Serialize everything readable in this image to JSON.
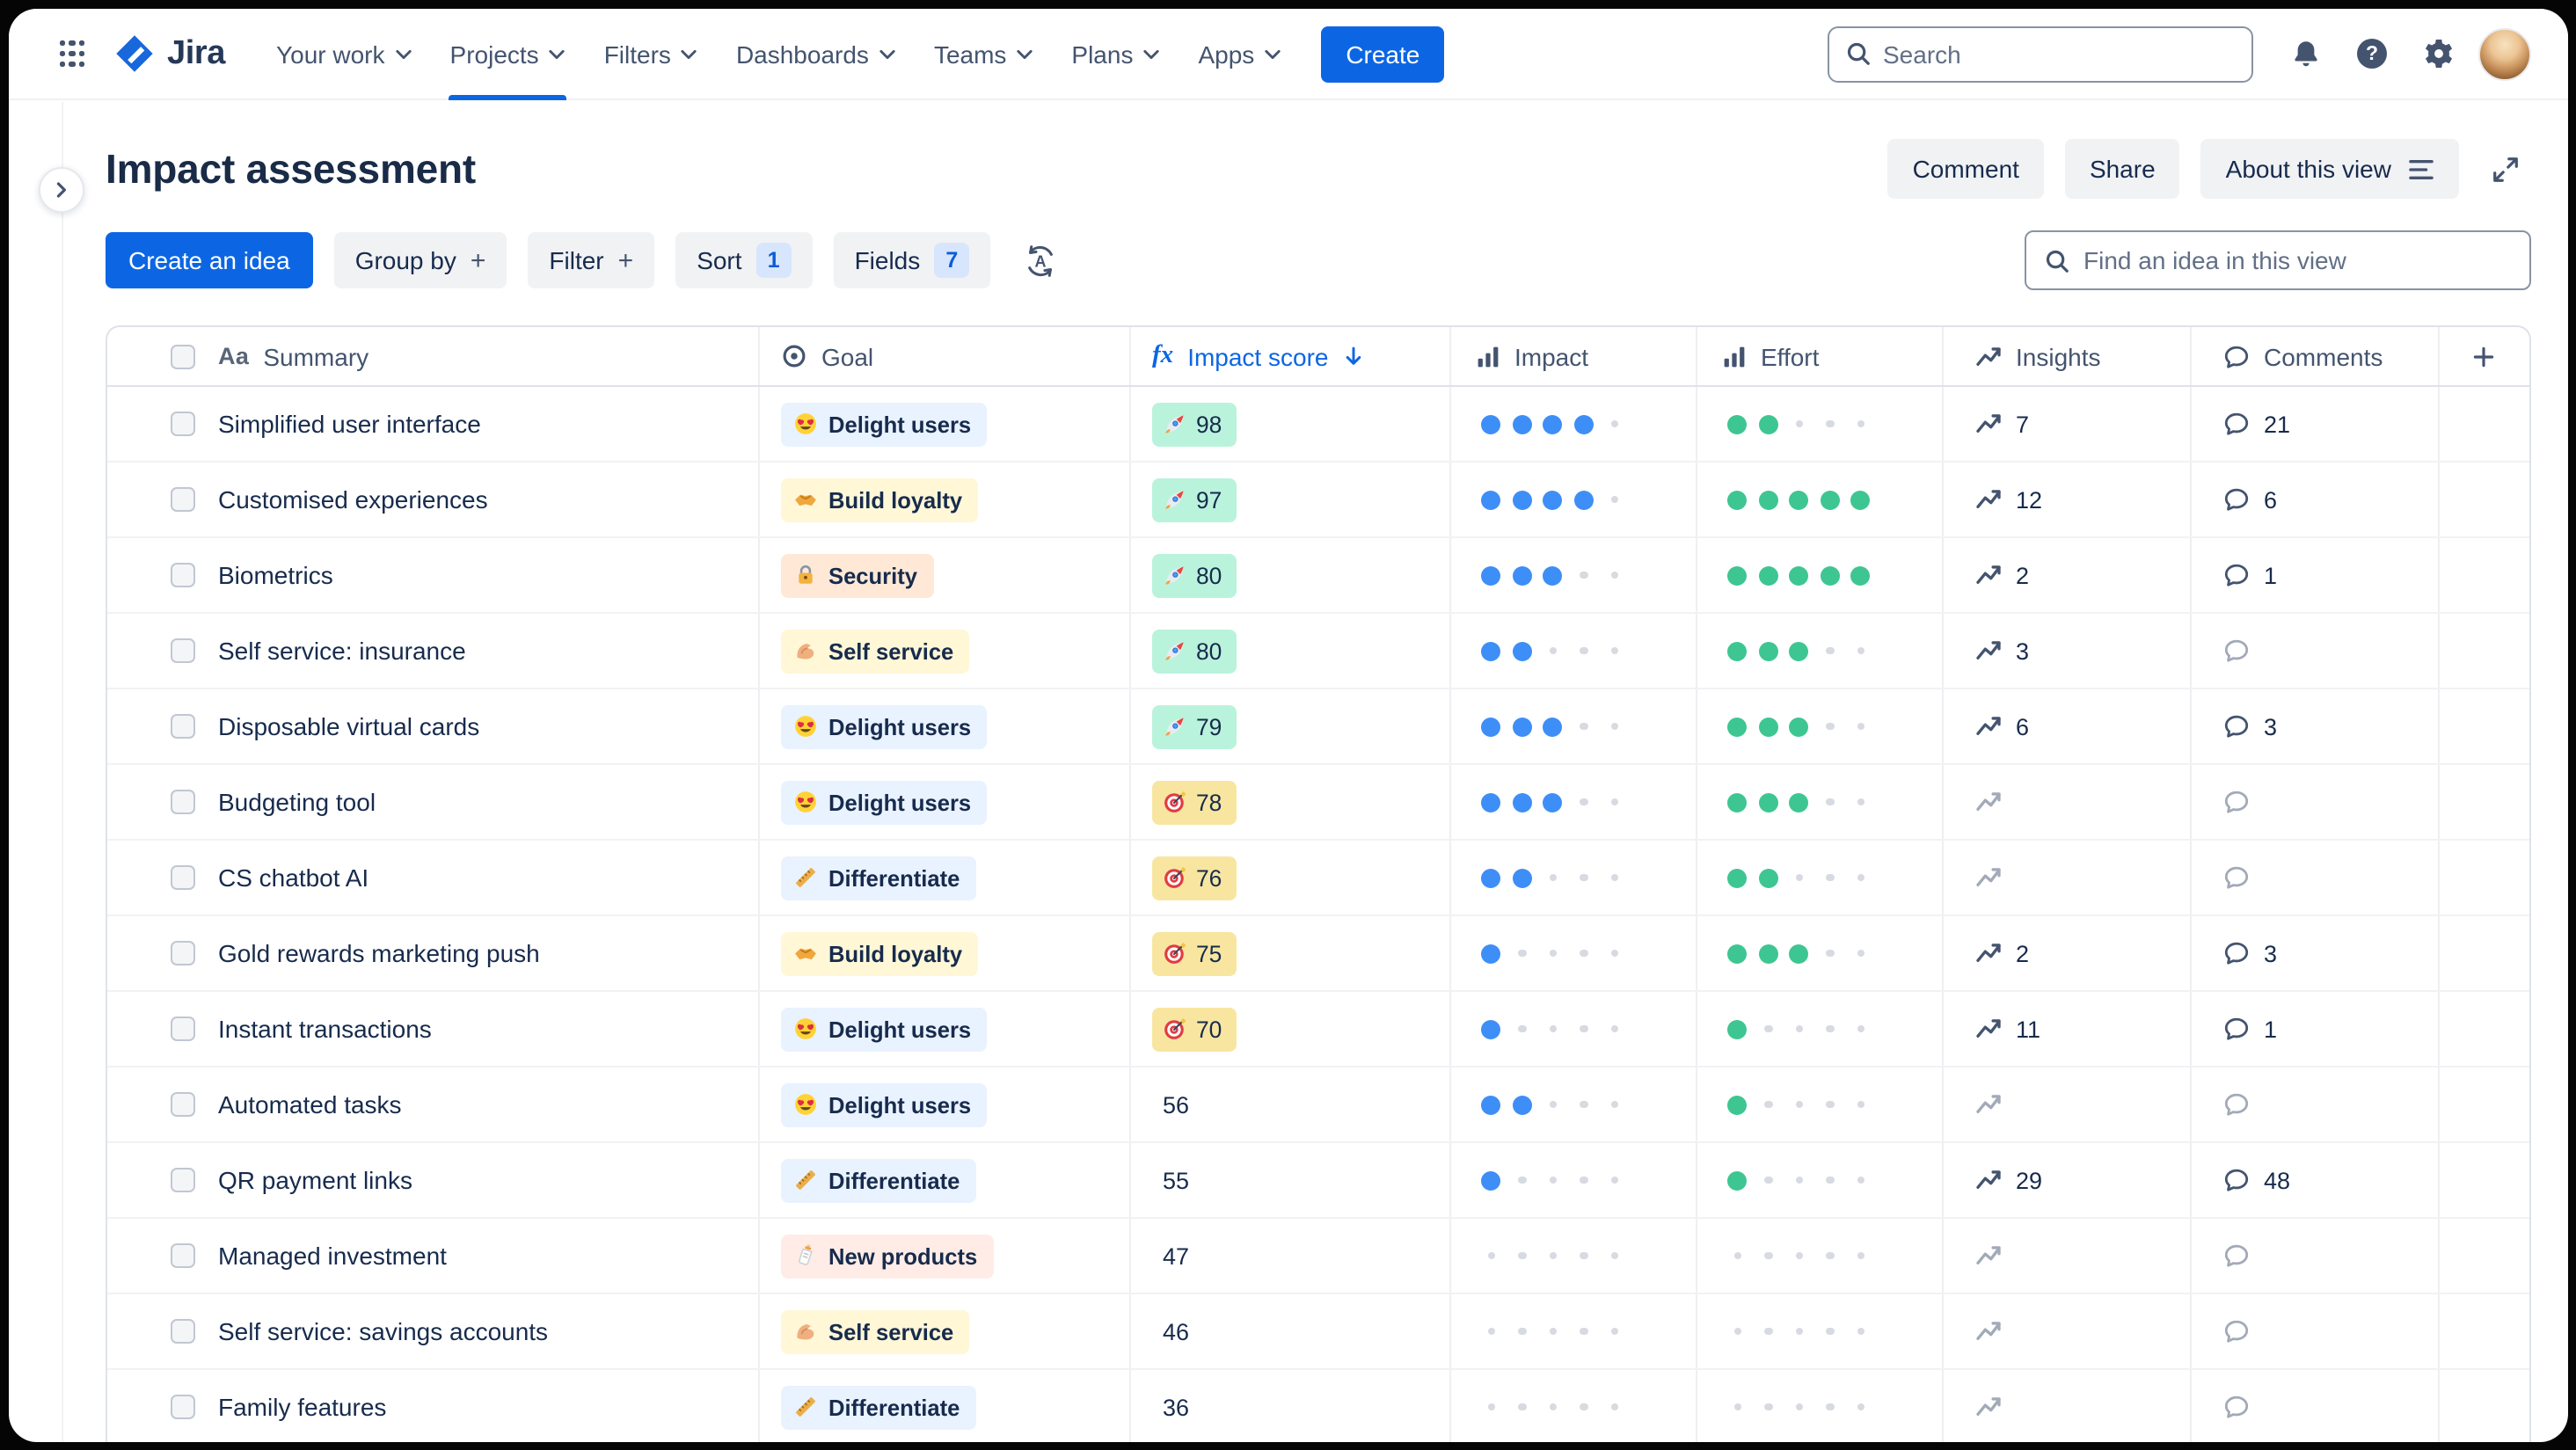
{
  "nav": {
    "logo_text": "Jira",
    "items": [
      "Your work",
      "Projects",
      "Filters",
      "Dashboards",
      "Teams",
      "Plans",
      "Apps"
    ],
    "active_item": "Projects",
    "create_label": "Create",
    "search_placeholder": "Search"
  },
  "page": {
    "title": "Impact assessment",
    "actions": {
      "comment": "Comment",
      "share": "Share",
      "about": "About this view"
    }
  },
  "toolbar": {
    "create_idea": "Create an idea",
    "group_by": "Group by",
    "filter": "Filter",
    "sort": "Sort",
    "sort_count": "1",
    "fields": "Fields",
    "fields_count": "7",
    "find_placeholder": "Find an idea in this view"
  },
  "table": {
    "columns": [
      "Summary",
      "Goal",
      "Impact score",
      "Impact",
      "Effort",
      "Insights",
      "Comments"
    ],
    "sorted_column": "Impact score",
    "sort_direction": "desc",
    "rating_max": 5,
    "rows": [
      {
        "summary": "Simplified user interface",
        "goal": "Delight users",
        "score": 98,
        "score_tier": "high",
        "impact": 4,
        "effort": 2,
        "insights": 7,
        "comments": 21
      },
      {
        "summary": "Customised experiences",
        "goal": "Build loyalty",
        "score": 97,
        "score_tier": "high",
        "impact": 4,
        "effort": 5,
        "insights": 12,
        "comments": 6
      },
      {
        "summary": "Biometrics",
        "goal": "Security",
        "score": 80,
        "score_tier": "high",
        "impact": 3,
        "effort": 5,
        "insights": 2,
        "comments": 1
      },
      {
        "summary": "Self service: insurance",
        "goal": "Self service",
        "score": 80,
        "score_tier": "high",
        "impact": 2,
        "effort": 3,
        "insights": 3,
        "comments": null
      },
      {
        "summary": "Disposable virtual cards",
        "goal": "Delight users",
        "score": 79,
        "score_tier": "high",
        "impact": 3,
        "effort": 3,
        "insights": 6,
        "comments": 3
      },
      {
        "summary": "Budgeting tool",
        "goal": "Delight users",
        "score": 78,
        "score_tier": "mid",
        "impact": 3,
        "effort": 3,
        "insights": null,
        "comments": null
      },
      {
        "summary": "CS chatbot AI",
        "goal": "Differentiate",
        "score": 76,
        "score_tier": "mid",
        "impact": 2,
        "effort": 2,
        "insights": null,
        "comments": null
      },
      {
        "summary": "Gold rewards marketing push",
        "goal": "Build loyalty",
        "score": 75,
        "score_tier": "mid",
        "impact": 1,
        "effort": 3,
        "insights": 2,
        "comments": 3
      },
      {
        "summary": "Instant transactions",
        "goal": "Delight users",
        "score": 70,
        "score_tier": "mid",
        "impact": 1,
        "effort": 1,
        "insights": 11,
        "comments": 1
      },
      {
        "summary": "Automated tasks",
        "goal": "Delight users",
        "score": 56,
        "score_tier": null,
        "impact": 2,
        "effort": 1,
        "insights": null,
        "comments": null
      },
      {
        "summary": "QR payment links",
        "goal": "Differentiate",
        "score": 55,
        "score_tier": null,
        "impact": 1,
        "effort": 1,
        "insights": 29,
        "comments": 48
      },
      {
        "summary": "Managed investment",
        "goal": "New products",
        "score": 47,
        "score_tier": null,
        "impact": 0,
        "effort": 0,
        "insights": null,
        "comments": null
      },
      {
        "summary": "Self service: savings accounts",
        "goal": "Self service",
        "score": 46,
        "score_tier": null,
        "impact": 0,
        "effort": 0,
        "insights": null,
        "comments": null
      },
      {
        "summary": "Family features",
        "goal": "Differentiate",
        "score": 36,
        "score_tier": null,
        "impact": 0,
        "effort": 0,
        "insights": null,
        "comments": null
      }
    ]
  },
  "goals": {
    "Delight users": {
      "icon": "heart-eyes",
      "bg": "#E9F2FF"
    },
    "Build loyalty": {
      "icon": "handshake",
      "bg": "#FFF7D6"
    },
    "Security": {
      "icon": "lock",
      "bg": "#FFE9D6"
    },
    "Self service": {
      "icon": "muscle",
      "bg": "#FFF7D6"
    },
    "Differentiate": {
      "icon": "ruler",
      "bg": "#E9F2FF"
    },
    "New products": {
      "icon": "baby-bottle",
      "bg": "#FFECE6"
    }
  },
  "colors": {
    "accent_blue": "#0C66E4",
    "impact_dot": "#3E8EF7",
    "effort_dot": "#3EC692",
    "empty_dot": "#D7DBE1",
    "score_high_bg": "#BAF3DB",
    "score_mid_bg": "#F8E6A0",
    "icon_active": "#44546F",
    "icon_empty": "#A2AAB8"
  }
}
